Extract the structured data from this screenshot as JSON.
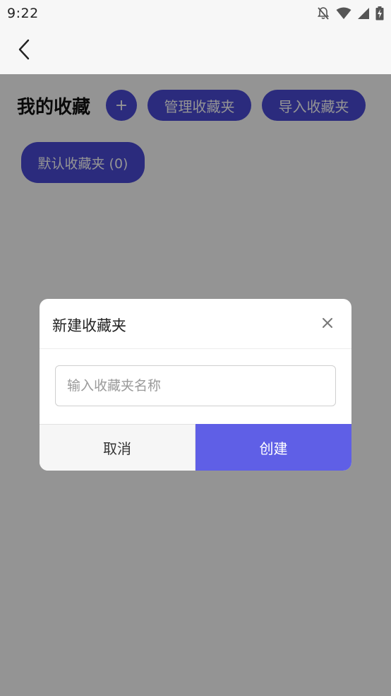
{
  "status_bar": {
    "time": "9:22",
    "icons": [
      "notifications-off-icon",
      "wifi-icon",
      "signal-icon",
      "battery-charging-icon"
    ]
  },
  "header": {
    "back_icon": "chevron-left-icon"
  },
  "main": {
    "title": "我的收藏",
    "add_label": "+",
    "manage_label": "管理收藏夹",
    "import_label": "导入收藏夹",
    "folders": [
      {
        "label": "默认收藏夹 (0)"
      }
    ]
  },
  "modal": {
    "title": "新建收藏夹",
    "close_icon": "close-icon",
    "input": {
      "value": "",
      "placeholder": "输入收藏夹名称"
    },
    "cancel_label": "取消",
    "create_label": "创建"
  },
  "colors": {
    "accent": "#4a4ad8",
    "create_button": "#5f5fe6",
    "overlay": "rgba(0,0,0,0.42)"
  }
}
